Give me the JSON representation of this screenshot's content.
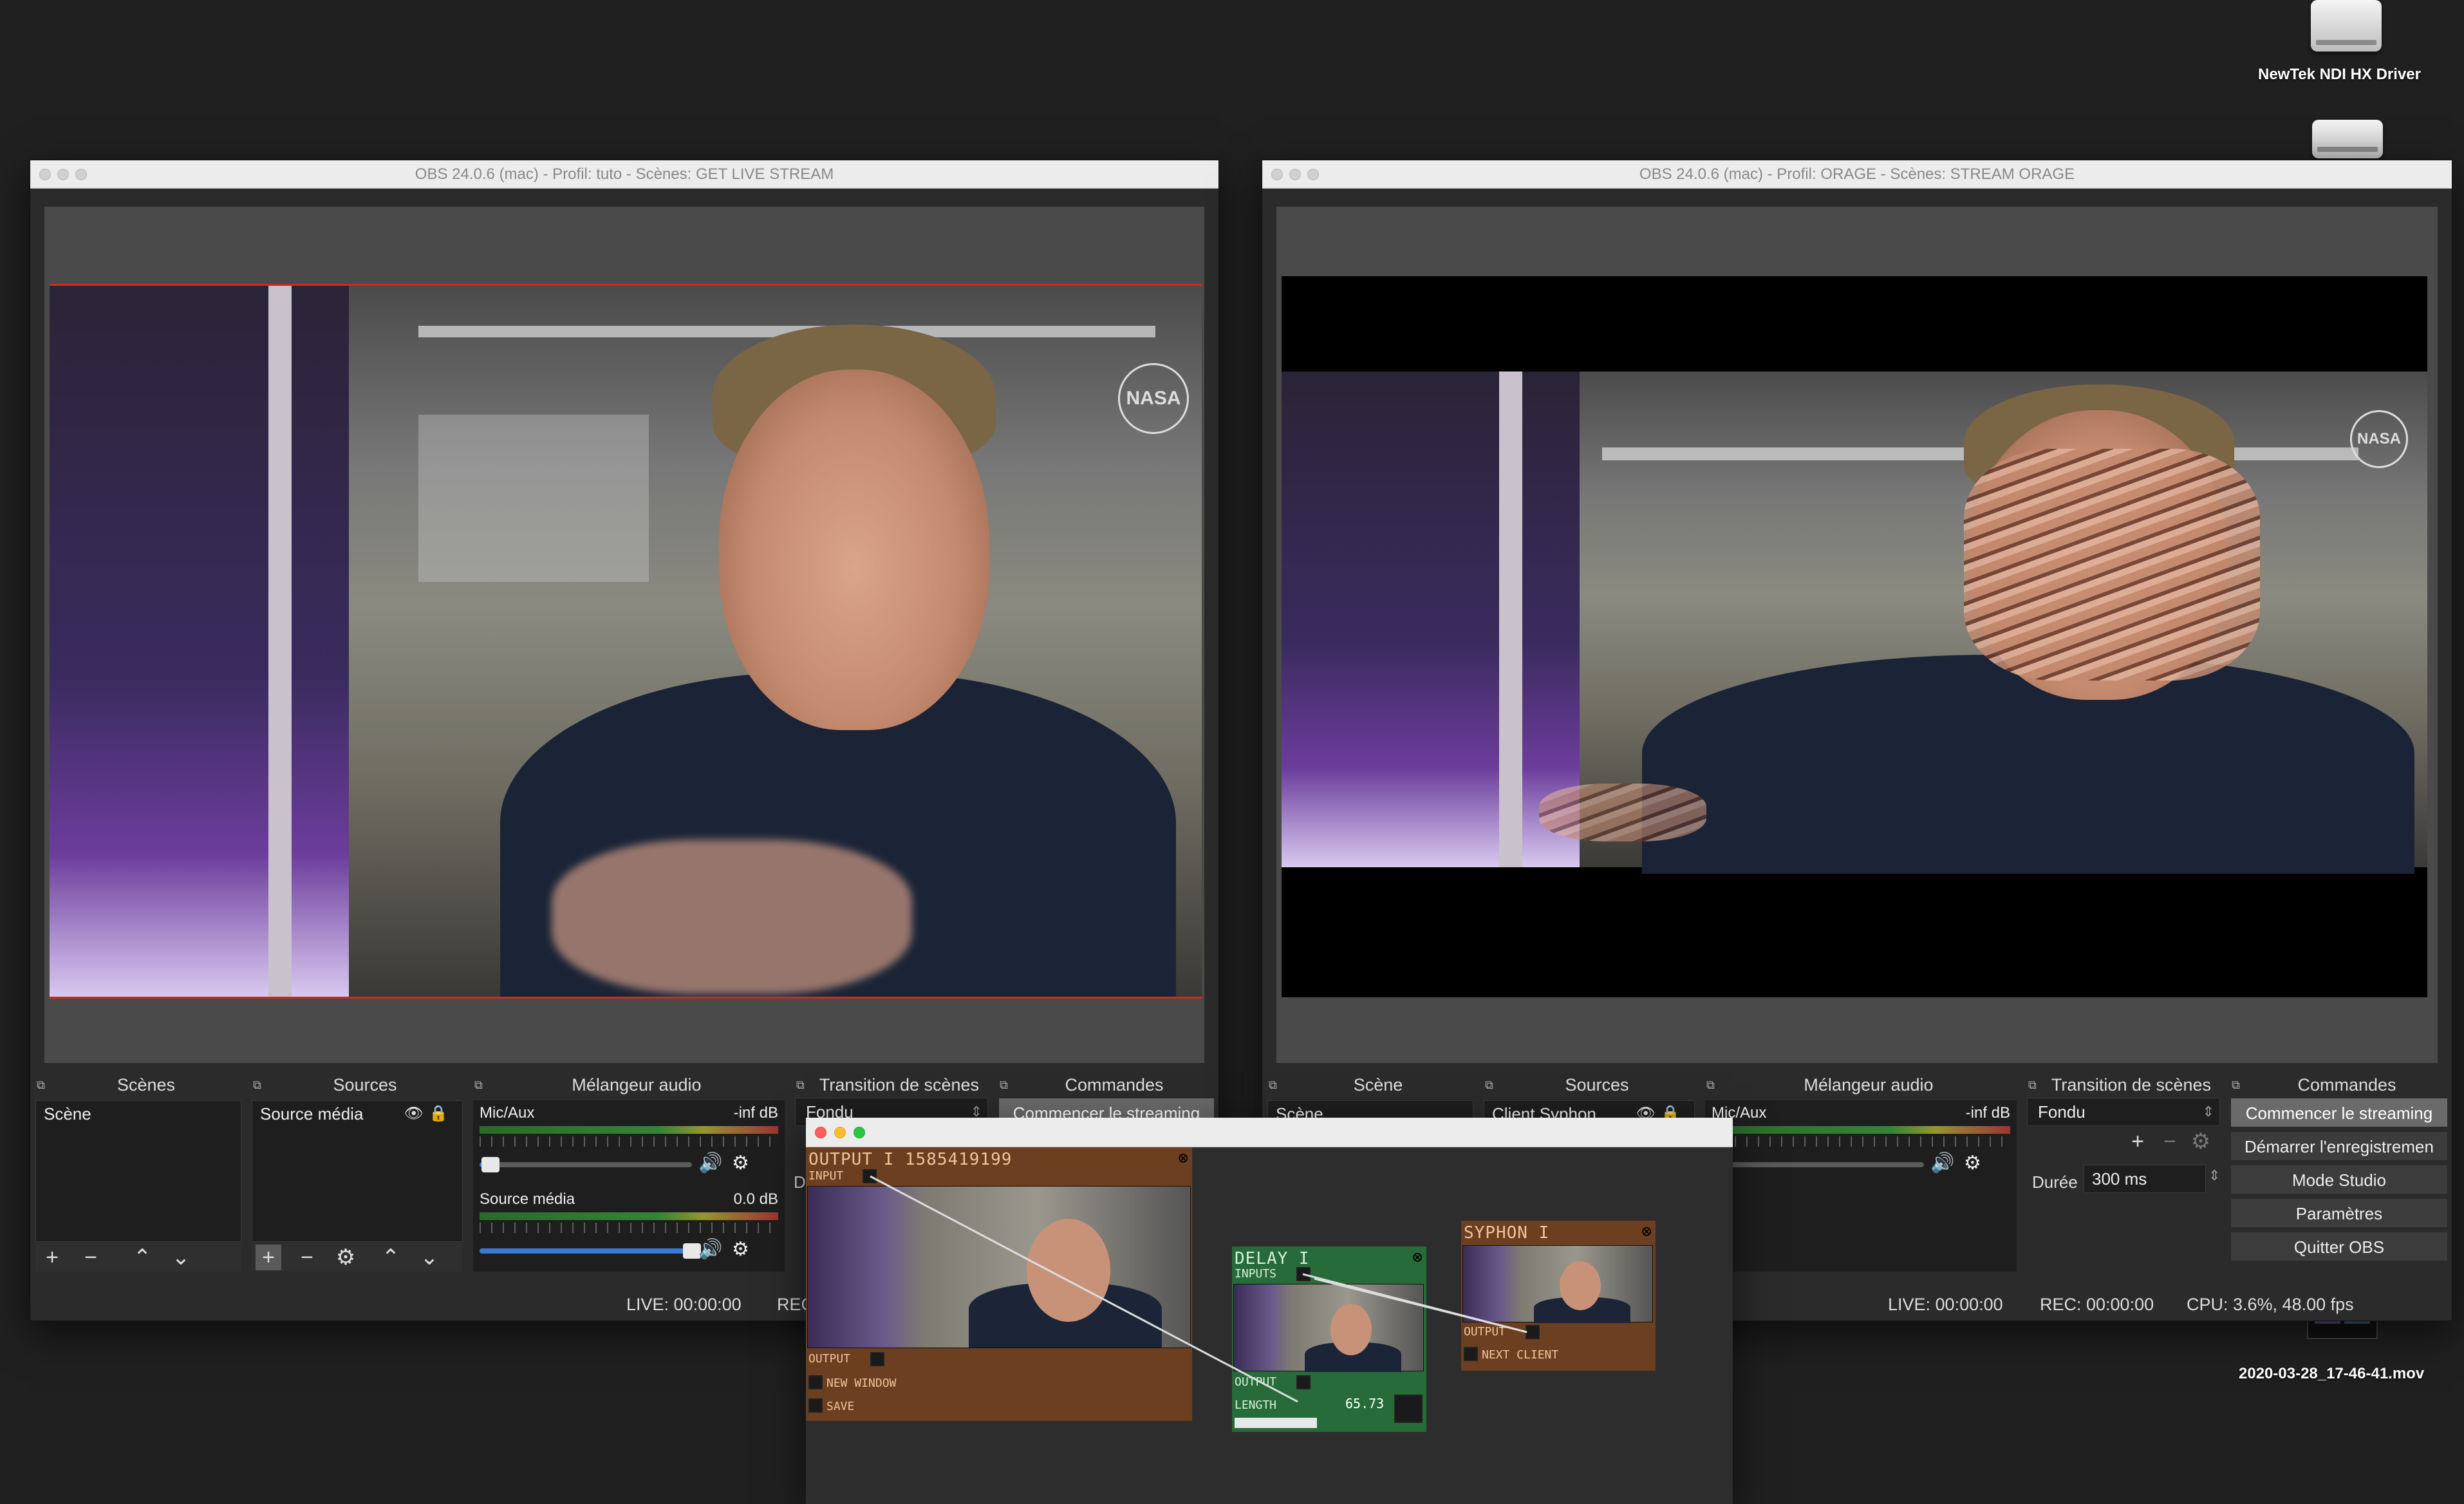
{
  "desktop": {
    "driver_label": "NewTek NDI HX Driver",
    "file_label": "2020-03-28_17-46-41.mov"
  },
  "obs_left": {
    "title": "OBS 24.0.6 (mac) - Profil: tuto - Scènes: GET LIVE STREAM",
    "docks": {
      "scenes_title": "Scènes",
      "sources_title": "Sources",
      "mixer_title": "Mélangeur audio",
      "transition_title": "Transition de scènes",
      "commands_title": "Commandes"
    },
    "scenes": [
      "Scène"
    ],
    "sources": [
      "Source média"
    ],
    "mixer": [
      {
        "name": "Mic/Aux",
        "db": "-inf dB",
        "volume": 0.05
      },
      {
        "name": "Source média",
        "db": "0.0 dB",
        "volume": 1.0
      }
    ],
    "transition": {
      "select": "Fondu",
      "duration_label": "Duré"
    },
    "commands": [
      "Commencer le streaming"
    ],
    "status": {
      "live": "LIVE: 00:00:00",
      "rec": "REC"
    }
  },
  "obs_right": {
    "title": "OBS 24.0.6 (mac) - Profil: ORAGE - Scènes: STREAM ORAGE",
    "docks": {
      "scenes_title": "Scène",
      "sources_title": "Sources",
      "mixer_title": "Mélangeur audio",
      "transition_title": "Transition de scènes",
      "commands_title": "Commandes"
    },
    "scenes": [
      "Scène"
    ],
    "sources": [
      "Client Syphon"
    ],
    "mixer": [
      {
        "name": "Mic/Aux",
        "db": "-inf dB",
        "volume": 0.05
      }
    ],
    "transition": {
      "select": "Fondu",
      "duration_label": "Durée",
      "duration_value": "300 ms"
    },
    "commands": [
      "Commencer le streaming",
      "Démarrer l'enregistremen",
      "Mode Studio",
      "Paramètres",
      "Quitter OBS"
    ],
    "status": {
      "live": "LIVE: 00:00:00",
      "rec": "REC: 00:00:00",
      "cpu": "CPU: 3.6%, 48.00 fps"
    }
  },
  "node_editor": {
    "actors": {
      "output": {
        "title": "OUTPUT I 1585419199",
        "input_label": "INPUT",
        "output_label": "OUTPUT",
        "new_window_label": "NEW WINDOW",
        "save_label": "SAVE"
      },
      "delay": {
        "title": "DELAY I",
        "inputs_label": "INPUTS",
        "output_label": "OUTPUT",
        "length_label": "LENGTH",
        "length_value": "65.73",
        "length_fraction": 0.44
      },
      "syphon": {
        "title": "SYPHON I",
        "output_label": "OUTPUT",
        "next_client_label": "NEXT CLIENT"
      }
    }
  },
  "colors": {
    "obs_bg": "#2b2b2b",
    "selection_red": "#d22222",
    "actor_orange": "#6b3f1f",
    "actor_green": "#276b3a"
  }
}
